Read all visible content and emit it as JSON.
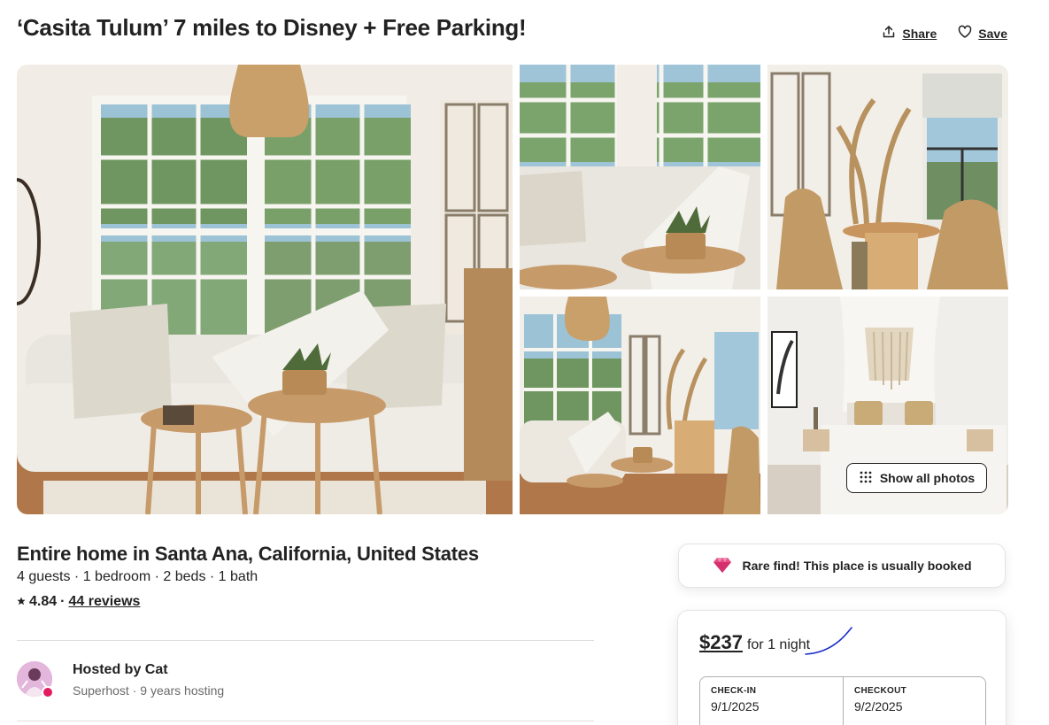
{
  "listing": {
    "title": "‘Casita Tulum’ 7 miles to Disney + Free Parking!",
    "share_label": "Share",
    "save_label": "Save",
    "show_all_photos_label": "Show all photos"
  },
  "summary": {
    "heading": "Entire home in Santa Ana, California, United States",
    "facts": "4 guests · 1 bedroom · 2 beds · 1 bath",
    "rating": "4.84",
    "separator": "·",
    "reviews_label": "44 reviews"
  },
  "host": {
    "name_line": "Hosted by Cat",
    "meta": "Superhost · 9 years hosting"
  },
  "booking": {
    "rare_find": "Rare find! This place is usually booked",
    "price": "$237",
    "price_suffix": "for 1 night",
    "checkin_label": "CHECK-IN",
    "checkin_value": "9/1/2025",
    "checkout_label": "CHECKOUT",
    "checkout_value": "9/2/2025"
  },
  "icons": {
    "share": "share-icon",
    "save": "heart-icon",
    "grid": "grid-dots-icon",
    "gem": "diamond-icon",
    "star": "star-icon"
  },
  "colors": {
    "text": "#222222",
    "muted": "#6a6a6a",
    "accent_pink": "#e31c5f",
    "border": "#dddddd"
  }
}
